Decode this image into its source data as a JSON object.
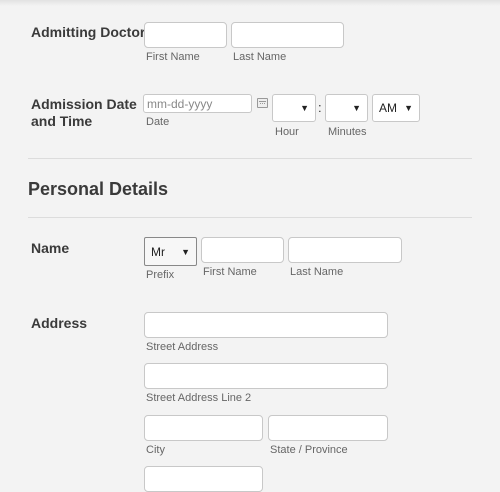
{
  "admitting_doctor": {
    "label": "Admitting Doctor",
    "first_name_sub": "First Name",
    "last_name_sub": "Last Name",
    "first_name_value": "",
    "last_name_value": ""
  },
  "admission": {
    "label_line1": "Admission Date",
    "label_line2": "and Time",
    "date_placeholder": "mm-dd-yyyy",
    "date_sub": "Date",
    "hour_value": "",
    "hour_sub": "Hour",
    "colon": ":",
    "minutes_value": "",
    "minutes_sub": "Minutes",
    "ampm_value": "AM",
    "calendar_icon": "calendar-icon"
  },
  "personal_details": {
    "title": "Personal Details"
  },
  "name": {
    "label": "Name",
    "prefix_value": "Mr",
    "prefix_sub": "Prefix",
    "first_name_sub": "First Name",
    "last_name_sub": "Last Name"
  },
  "address": {
    "label": "Address",
    "street_sub": "Street Address",
    "street2_sub": "Street Address Line 2",
    "city_sub": "City",
    "state_sub": "State / Province"
  }
}
